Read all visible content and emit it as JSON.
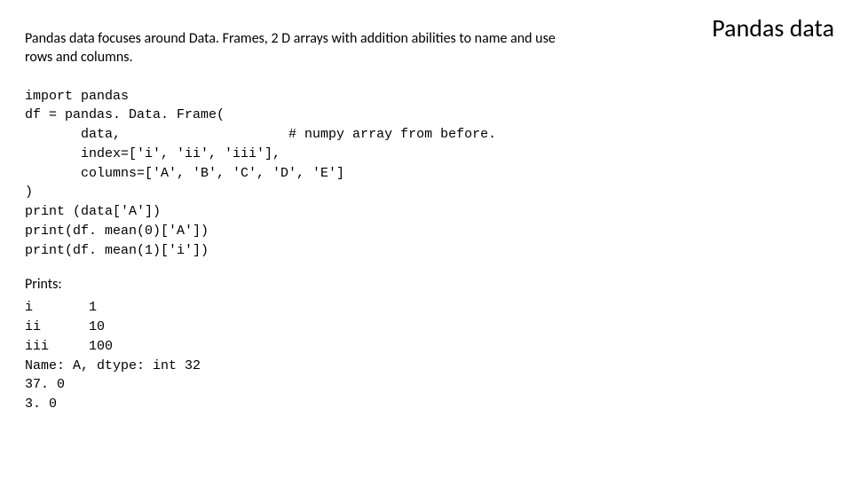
{
  "title": "Pandas data",
  "intro": "Pandas data focuses around Data. Frames, 2 D arrays with addition abilities to name and use rows and columns.",
  "code": "import pandas\ndf = pandas. Data. Frame(\n       data,                     # numpy array from before.\n       index=['i', 'ii', 'iii'],\n       columns=['A', 'B', 'C', 'D', 'E']\n)\nprint (data['A'])\nprint(df. mean(0)['A'])\nprint(df. mean(1)['i'])",
  "prints_label": "Prints:",
  "output": "i       1\nii      10\niii     100\nName: A, dtype: int 32\n37. 0\n3. 0"
}
